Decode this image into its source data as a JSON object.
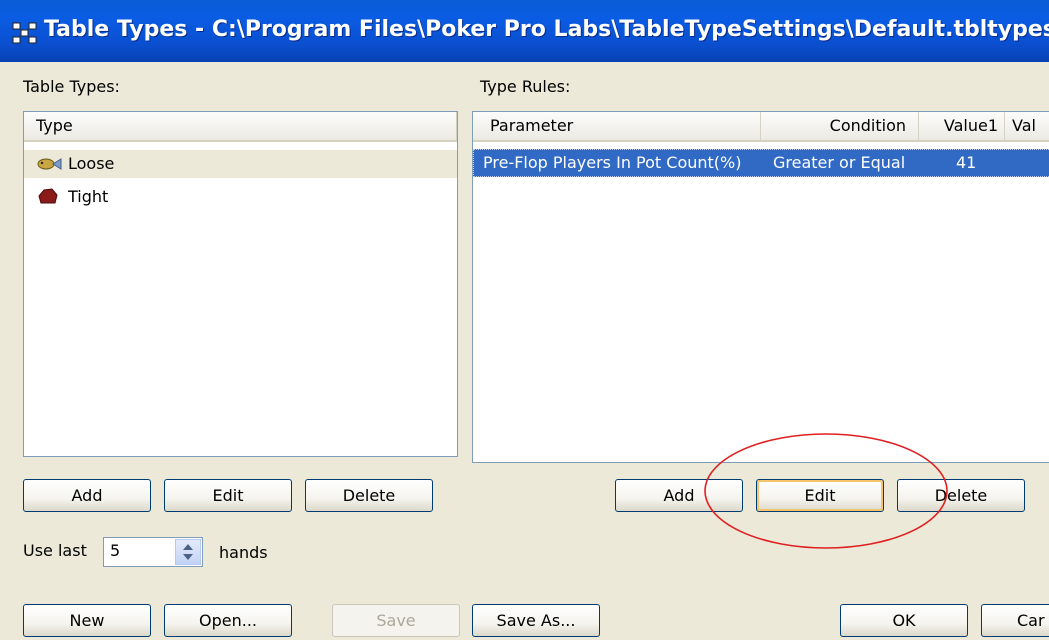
{
  "window": {
    "title": "Table Types - C:\\Program Files\\Poker Pro Labs\\TableTypeSettings\\Default.tbltypes"
  },
  "left": {
    "label": "Table Types:",
    "column_header": "Type",
    "items": [
      {
        "label": "Loose",
        "icon": "fish-icon"
      },
      {
        "label": "Tight",
        "icon": "rock-icon"
      }
    ],
    "add_label": "Add",
    "edit_label": "Edit",
    "delete_label": "Delete"
  },
  "right": {
    "label": "Type Rules:",
    "columns": [
      "Parameter",
      "Condition",
      "Value1",
      "Val"
    ],
    "rows": [
      {
        "parameter": "Pre-Flop Players In Pot Count(%)",
        "condition": "Greater or Equal",
        "value1": "41"
      }
    ],
    "add_label": "Add",
    "edit_label": "Edit",
    "delete_label": "Delete"
  },
  "use_last": {
    "prefix": "Use last",
    "value": "5",
    "suffix": "hands"
  },
  "bottom": {
    "new_label": "New",
    "open_label": "Open...",
    "save_label": "Save",
    "save_as_label": "Save As...",
    "ok_label": "OK",
    "cancel_label": "Car"
  },
  "colors": {
    "title_bar": "#0a5ce3",
    "selection": "#316ac5",
    "annotation_circle": "#e02020"
  }
}
